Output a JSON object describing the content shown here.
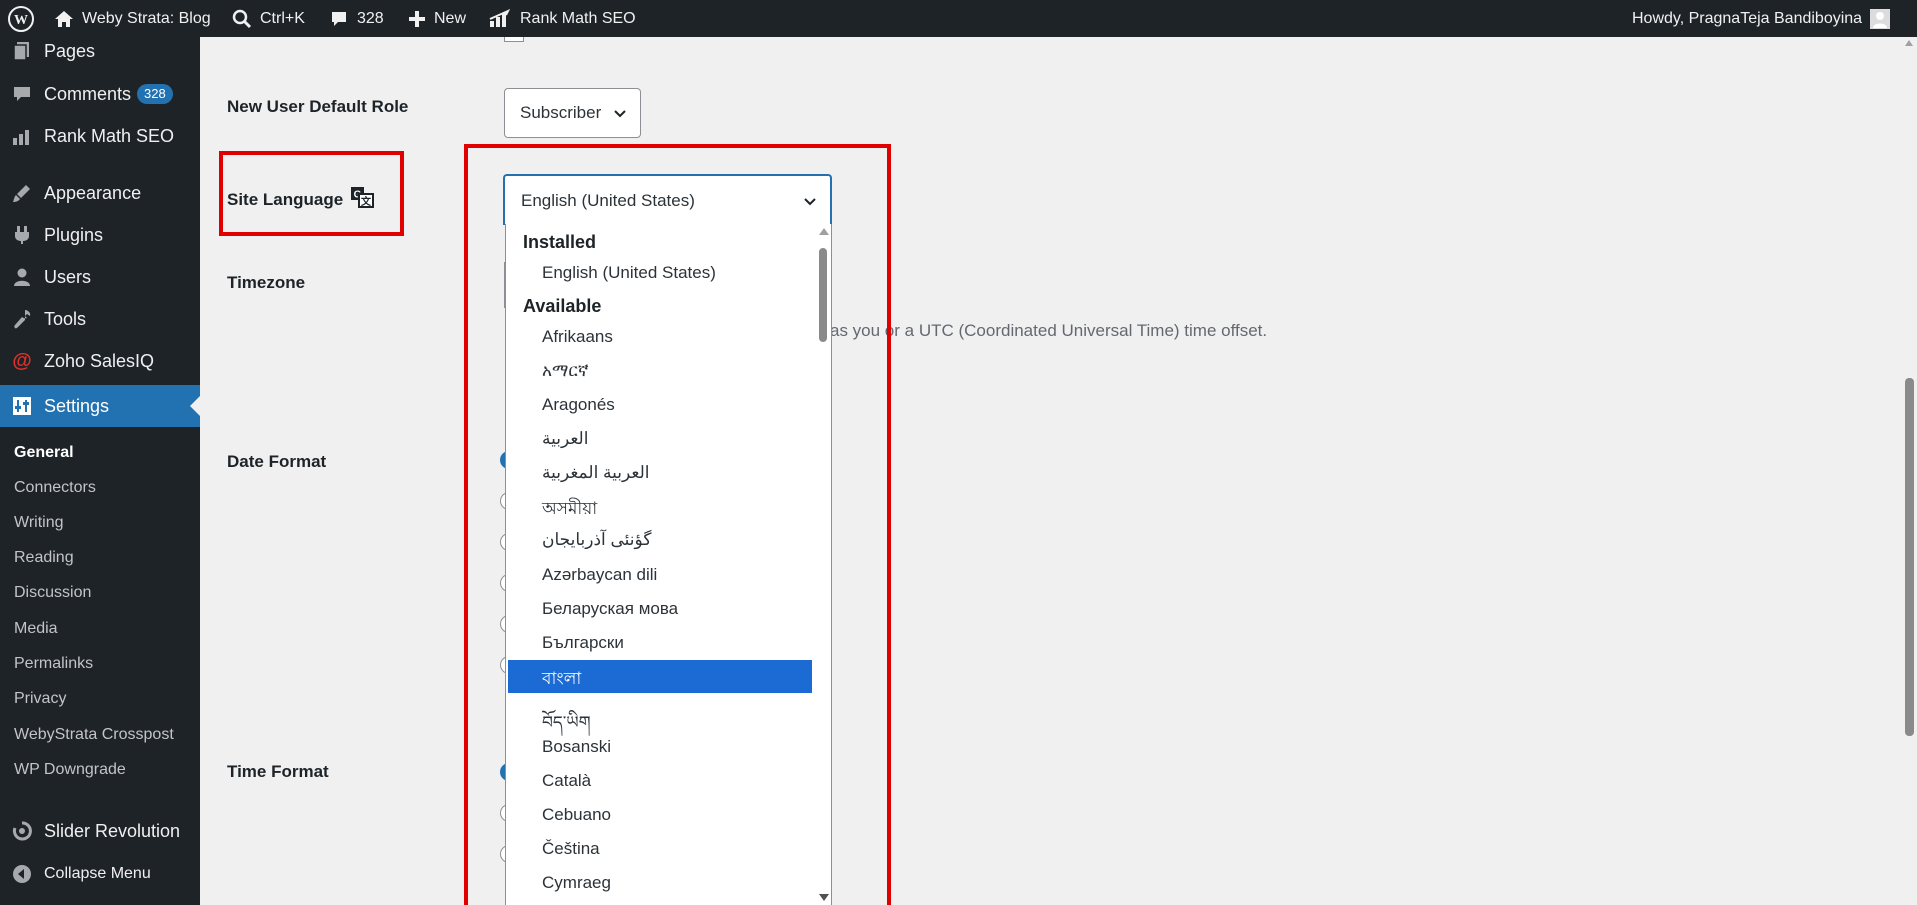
{
  "adminbar": {
    "site_name": "Weby Strata: Blog",
    "search_shortcut": "Ctrl+K",
    "comments_count": "328",
    "new_label": "New",
    "rankmath_label": "Rank Math SEO",
    "howdy": "Howdy, PragnaTeja Bandiboyina"
  },
  "sidebar": {
    "pages": "Pages",
    "comments": "Comments",
    "comments_badge": "328",
    "rankmath": "Rank Math SEO",
    "appearance": "Appearance",
    "plugins": "Plugins",
    "users": "Users",
    "tools": "Tools",
    "zoho": "Zoho SalesIQ",
    "settings": "Settings",
    "submenu": [
      "General",
      "Connectors",
      "Writing",
      "Reading",
      "Discussion",
      "Media",
      "Permalinks",
      "Privacy",
      "WebyStrata Crosspost",
      "WP Downgrade"
    ],
    "slider": "Slider Revolution",
    "collapse": "Collapse Menu"
  },
  "form": {
    "default_role_label": "New User Default Role",
    "default_role_value": "Subscriber",
    "site_language_label": "Site Language",
    "site_language_value": "English (United States)",
    "timezone_label": "Timezone",
    "timezone_hint": "as you or a UTC (Coordinated Universal Time) time offset.",
    "date_format_label": "Date Format",
    "time_format_label": "Time Format"
  },
  "language_dropdown": {
    "installed_label": "Installed",
    "installed": [
      "English (United States)"
    ],
    "available_label": "Available",
    "available": [
      "Afrikaans",
      "አማርኛ",
      "Aragonés",
      "العربية",
      "العربية المغربية",
      "অসমীয়া",
      "گؤنئی آذربایجان",
      "Azərbaycan dili",
      "Беларуская мова",
      "Български",
      "বাংলা",
      "བོད་ཡིག",
      "Bosanski",
      "Català",
      "Cebuano",
      "Čeština",
      "Cymraeg"
    ],
    "highlighted": "বাংলা"
  },
  "colors": {
    "admin_dark": "#1d2327",
    "accent": "#2271b1",
    "highlight": "#1c6bd4",
    "annotation_red": "#e00000"
  }
}
